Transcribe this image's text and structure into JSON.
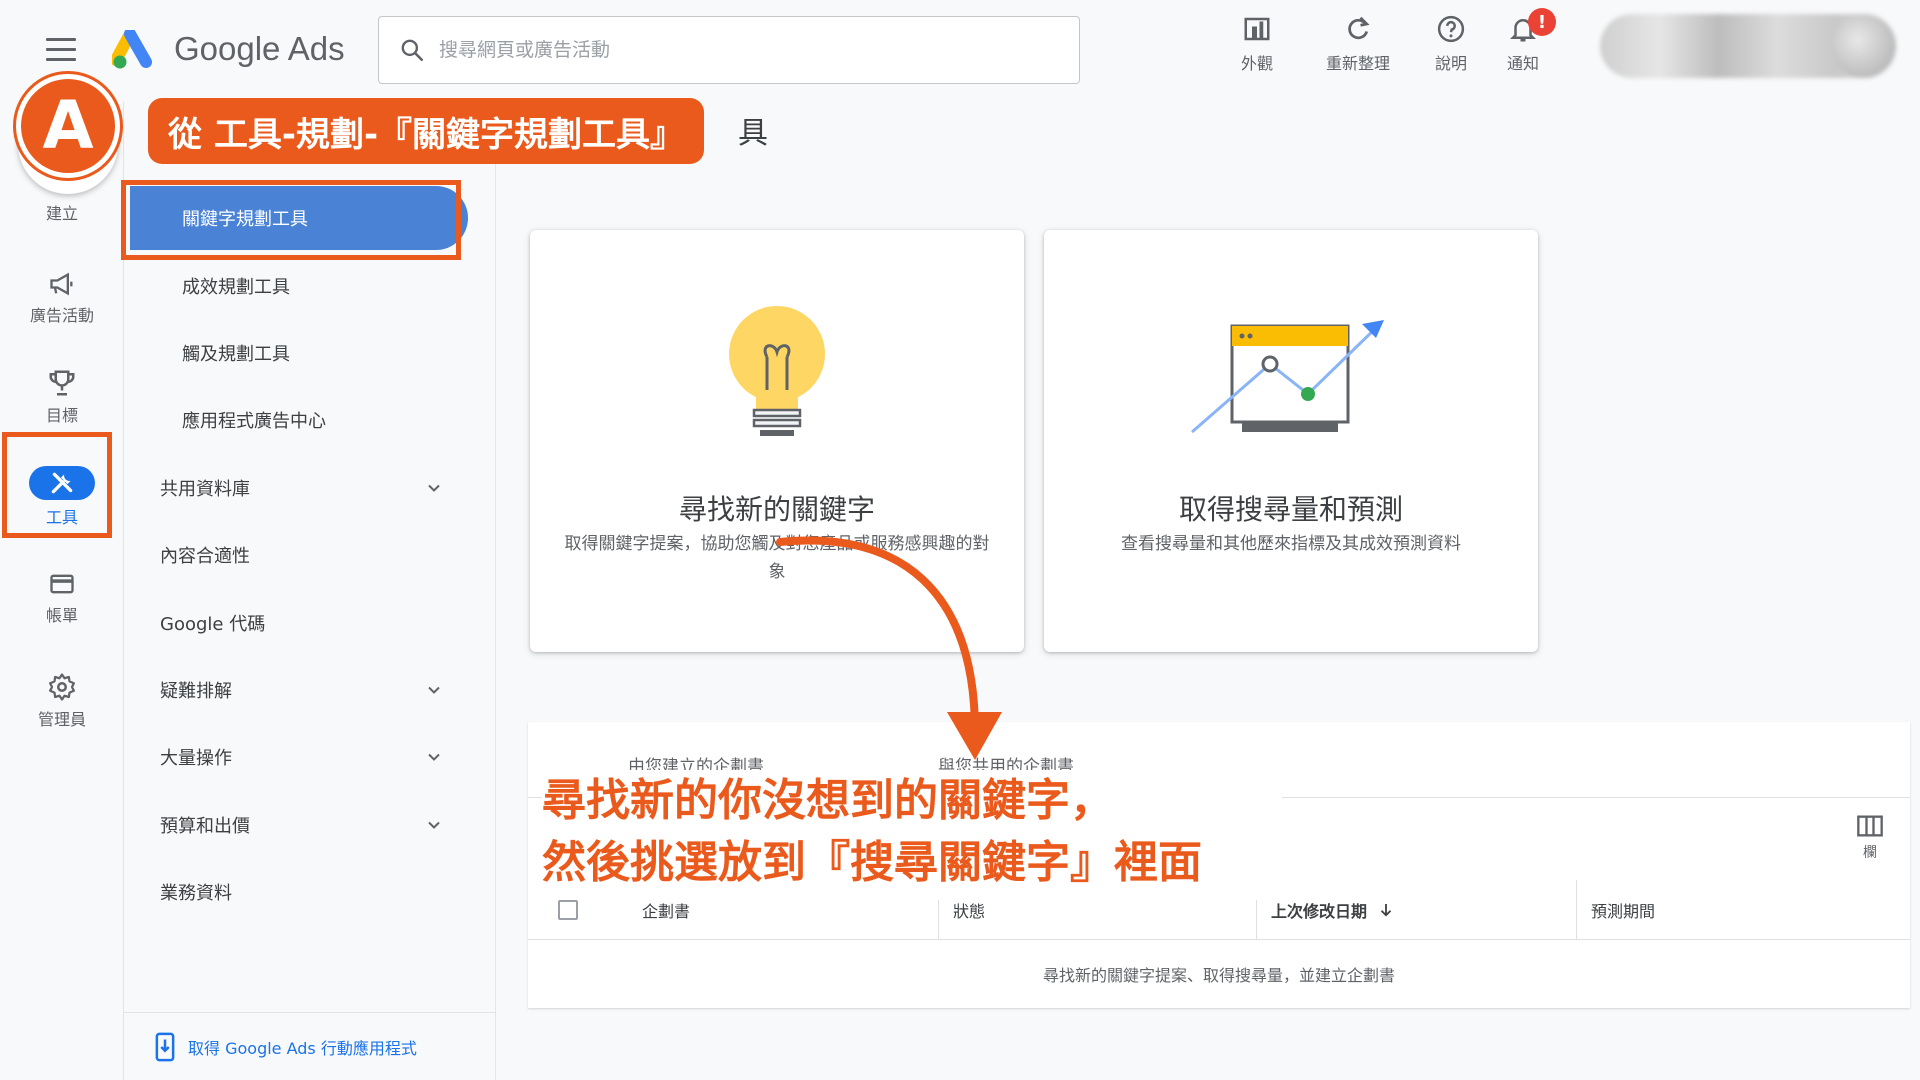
{
  "header": {
    "logo_text": "Google Ads",
    "search_placeholder": "搜尋網頁或廣告活動",
    "actions": [
      {
        "label": "外觀",
        "icon": "appearance-icon"
      },
      {
        "label": "重新整理",
        "icon": "refresh-icon"
      },
      {
        "label": "說明",
        "icon": "help-icon"
      },
      {
        "label": "通知",
        "icon": "bell-icon"
      }
    ],
    "notification_badge": "!"
  },
  "rail": {
    "items": [
      {
        "label": "建立",
        "icon": "plus-icon"
      },
      {
        "label": "廣告活動",
        "icon": "megaphone-icon"
      },
      {
        "label": "目標",
        "icon": "trophy-icon"
      },
      {
        "label": "工具",
        "icon": "tools-icon",
        "active": true
      },
      {
        "label": "帳單",
        "icon": "credit-card-icon"
      },
      {
        "label": "管理員",
        "icon": "gear-icon"
      }
    ]
  },
  "submenu": {
    "items": [
      {
        "label": "關鍵字規劃工具",
        "selected": true
      },
      {
        "label": "成效規劃工具"
      },
      {
        "label": "觸及規劃工具"
      },
      {
        "label": "應用程式廣告中心"
      },
      {
        "label": "共用資料庫",
        "expandable": true
      },
      {
        "label": "內容合適性"
      },
      {
        "label": "Google 代碼"
      },
      {
        "label": "疑難排解",
        "expandable": true
      },
      {
        "label": "大量操作",
        "expandable": true
      },
      {
        "label": "預算和出價",
        "expandable": true
      },
      {
        "label": "業務資料"
      }
    ],
    "footer_link": "取得 Google Ads 行動應用程式"
  },
  "cards": [
    {
      "title": "尋找新的關鍵字",
      "description": "取得關鍵字提案，協助您觸及對您產品或服務感興趣的對象",
      "icon": "lightbulb-icon"
    },
    {
      "title": "取得搜尋量和預測",
      "description": "查看搜尋量和其他歷來指標及其成效預測資料",
      "icon": "forecast-chart-icon"
    }
  ],
  "plans": {
    "tabs": [
      "由您建立的企劃書",
      "與您共用的企劃書"
    ],
    "columns_label": "欄",
    "table_headers": [
      "企劃書",
      "狀態",
      "上次修改日期",
      "預測期間"
    ],
    "empty_message": "尋找新的關鍵字提案、取得搜尋量，並建立企劃書"
  },
  "annotations": {
    "badge_letter": "A",
    "callout": "從 工具-規劃-『關鍵字規劃工具』",
    "callout_trailing": "具",
    "note_line1": "尋找新的你沒想到的關鍵字，",
    "note_line2": "然後挑選放到『搜尋關鍵字』裡面",
    "accent_color": "#ea5a1c"
  },
  "colors": {
    "primary_blue": "#1a73e8",
    "selected_blue": "#4a83d6",
    "badge_red": "#ea4335"
  }
}
